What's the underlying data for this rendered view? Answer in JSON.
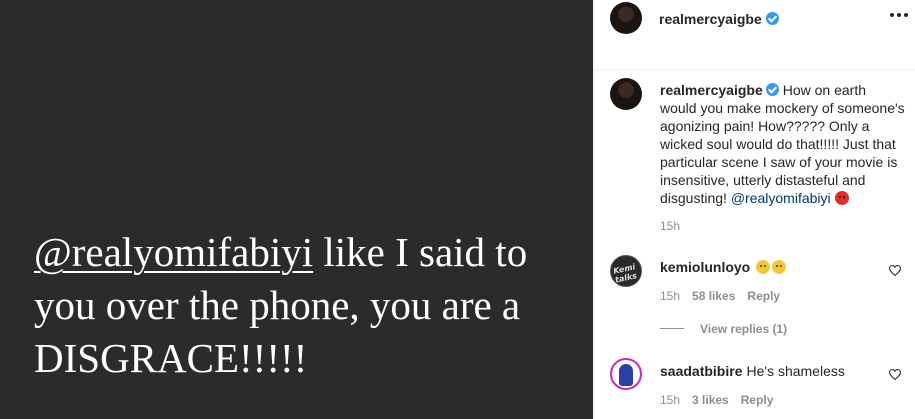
{
  "post": {
    "image_text": {
      "mention": "@realyomifabiyi",
      "text": " like I said to you over the phone, you are a DISGRACE!!!!!"
    }
  },
  "header": {
    "username": "realmercyaigbe"
  },
  "caption": {
    "username": "realmercyaigbe",
    "text": "How on earth would you make mockery of someone's agonizing pain! How????? Only a wicked soul would do that!!!!! Just that particular scene I saw of your movie is insensitive, utterly distasteful and disgusting!",
    "mention": "@realyomifabiyi",
    "time": "15h"
  },
  "comments": [
    {
      "username": "kemiolunloyo",
      "avatar_text": "Kemi talks",
      "text": "",
      "time": "15h",
      "likes": "58 likes",
      "reply_label": "Reply",
      "view_replies": "View replies (1)"
    },
    {
      "username": "saadatbibire",
      "text": "He's shameless",
      "time": "15h",
      "likes": "3 likes",
      "reply_label": "Reply"
    }
  ],
  "colors": {
    "image_background": "#2b2b2b",
    "verified_blue": "#3897f0",
    "mention_link": "#00376b",
    "secondary_text": "#8e8e8e"
  },
  "icons": [
    "verified-badge-icon",
    "more-options-icon",
    "heart-icon",
    "angry-face-emoji",
    "sad-face-emoji"
  ]
}
